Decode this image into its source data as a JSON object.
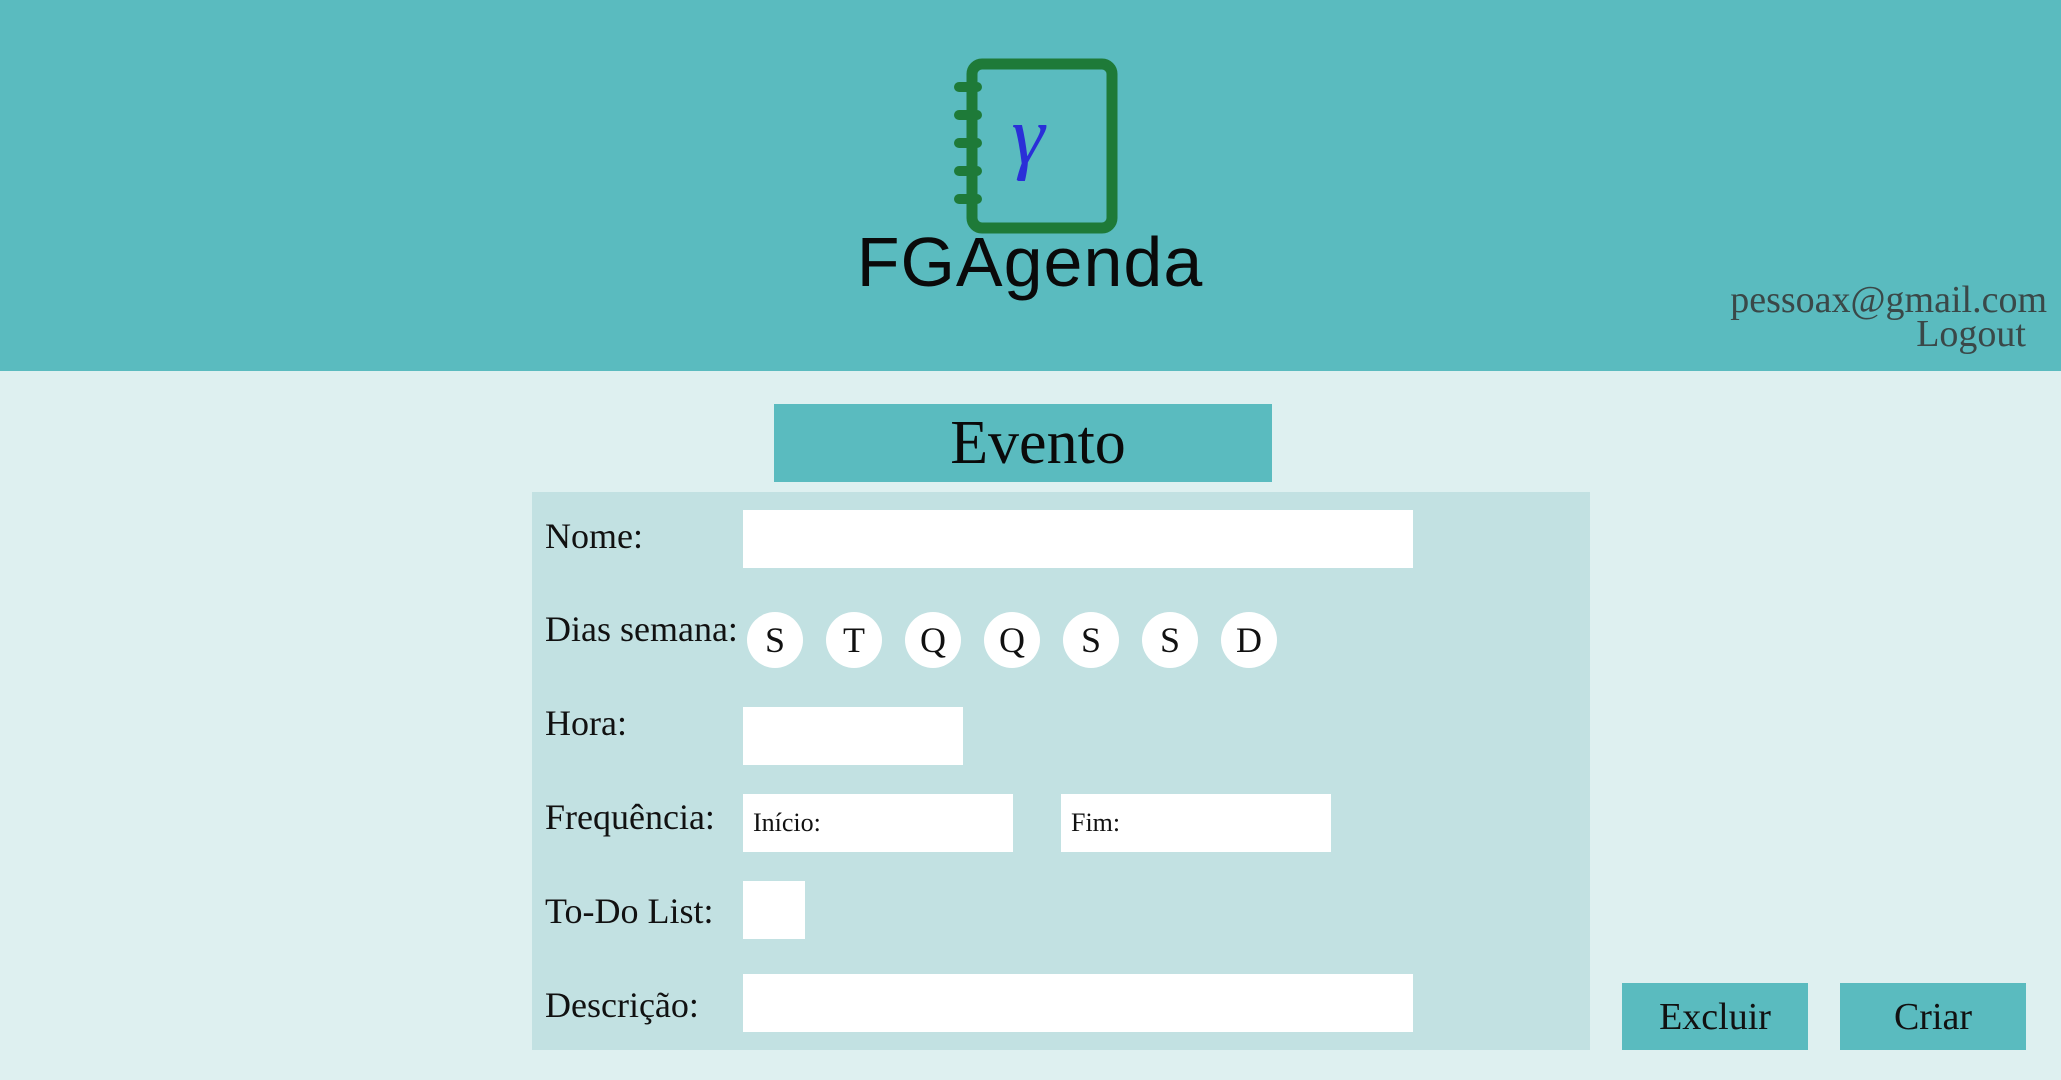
{
  "header": {
    "brand": "FGAgenda",
    "logo_glyph": "γ",
    "logo_icon": "notebook-icon",
    "user_email": "pessoax@gmail.com",
    "logout_label": "Logout"
  },
  "form": {
    "title": "Evento",
    "labels": {
      "nome": "Nome:",
      "dias_semana": "Dias semana:",
      "hora": "Hora:",
      "frequencia": "Frequência:",
      "todo": "To-Do List:",
      "descricao": "Descrição:"
    },
    "values": {
      "nome": "",
      "hora": "",
      "descricao": ""
    },
    "placeholders": {
      "inicio": "Início:",
      "fim": "Fim:"
    },
    "days": [
      "S",
      "T",
      "Q",
      "Q",
      "S",
      "S",
      "D"
    ]
  },
  "actions": {
    "delete_label": "Excluir",
    "create_label": "Criar"
  },
  "colors": {
    "header_bg": "#5abbbf",
    "page_bg": "#def0f0",
    "panel_bg": "#c2e1e2",
    "logo_green": "#1e7a38",
    "logo_glyph_blue": "#2a2fd8"
  }
}
